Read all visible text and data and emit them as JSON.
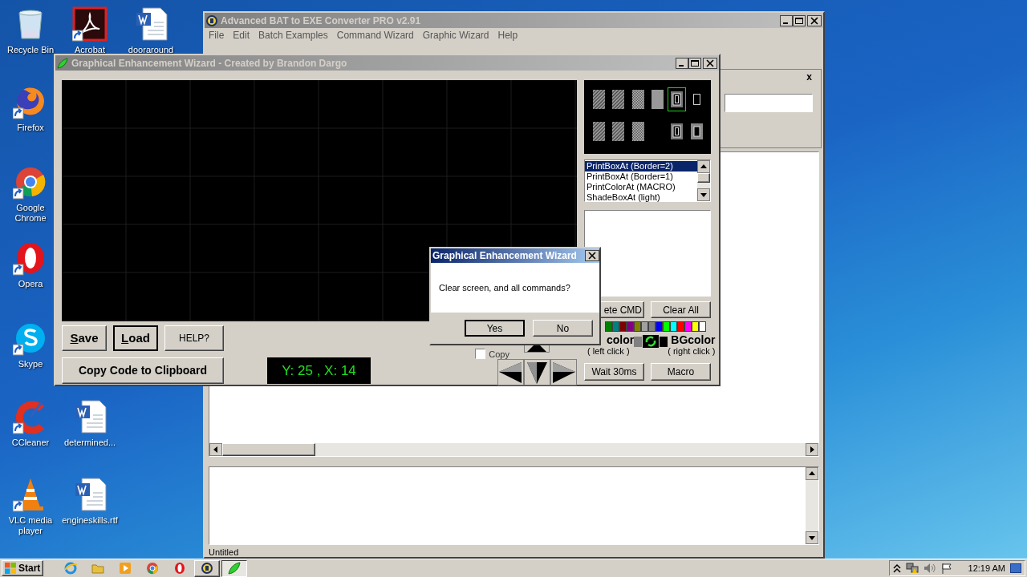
{
  "desktop_icons": [
    {
      "label": "Recycle Bin",
      "kind": "recycle",
      "shortcut": false
    },
    {
      "label": "Acrobat",
      "kind": "pdf",
      "shortcut": true
    },
    {
      "label": "dooraround",
      "kind": "word",
      "shortcut": false
    },
    {
      "label": "Firefox",
      "kind": "firefox",
      "shortcut": true
    },
    {
      "label": "Google Chrome",
      "kind": "chrome",
      "shortcut": true
    },
    {
      "label": "Opera",
      "kind": "opera",
      "shortcut": true
    },
    {
      "label": "Skype",
      "kind": "skype",
      "shortcut": true
    },
    {
      "label": "CCleaner",
      "kind": "ccleaner",
      "shortcut": true
    },
    {
      "label": "determined...",
      "kind": "word",
      "shortcut": false
    },
    {
      "label": "VLC media player",
      "kind": "vlc",
      "shortcut": true
    },
    {
      "label": "engineskills.rtf",
      "kind": "word",
      "shortcut": false
    }
  ],
  "main_window": {
    "title": "Advanced BAT to EXE Converter PRO v2.91",
    "active": false,
    "menu": [
      "File",
      "Edit",
      "Batch Examples",
      "Command Wizard",
      "Graphic Wizard",
      "Help"
    ],
    "panel_close": "x",
    "status": "Untitled"
  },
  "wizard": {
    "title": "Graphical Enhancement Wizard - Created by Brandon Dargo",
    "active": false,
    "tiles": [
      {
        "kind": "hatch",
        "selected": false
      },
      {
        "kind": "hatch",
        "selected": false
      },
      {
        "kind": "checker",
        "selected": false
      },
      {
        "kind": "solid",
        "selected": false
      },
      {
        "kind": "box2",
        "selected": true
      },
      {
        "kind": "box1",
        "selected": false
      },
      {
        "kind": "hatch",
        "selected": false
      },
      {
        "kind": "hatch",
        "selected": false
      },
      {
        "kind": "checker",
        "selected": false
      },
      {
        "kind": "empty",
        "selected": false
      },
      {
        "kind": "box2",
        "selected": false
      },
      {
        "kind": "boxfill",
        "selected": false
      }
    ],
    "commands": [
      {
        "label": "PrintBoxAt (Border=2)",
        "selected": true
      },
      {
        "label": "PrintBoxAt (Border=1)",
        "selected": false
      },
      {
        "label": "PrintColorAt (MACRO)",
        "selected": false
      },
      {
        "label": "ShadeBoxAt (light)",
        "selected": false
      }
    ],
    "buttons": {
      "save": "Save",
      "load": "Load",
      "help": "HELP?",
      "copy": "Copy Code to Clipboard",
      "delete": "ete CMD",
      "clear": "Clear All",
      "wait": "Wait 30ms",
      "macro": "Macro"
    },
    "palette": [
      {
        "color": "#008000"
      },
      {
        "color": "#008080"
      },
      {
        "color": "#800000"
      },
      {
        "color": "#800080"
      },
      {
        "color": "#808000"
      },
      {
        "color": "#a0a0a0"
      },
      {
        "color": "#808080"
      },
      {
        "color": "#0000ff"
      },
      {
        "color": "#00ff00"
      },
      {
        "color": "#00ffff"
      },
      {
        "color": "#ff0000"
      },
      {
        "color": "#ff00ff"
      },
      {
        "color": "#ffff00"
      },
      {
        "color": "#ffffff"
      }
    ],
    "fg_label": "color",
    "fg_hint": "( left click )",
    "fg_swatch": {
      "color": "#808080"
    },
    "bg_label": "BGcolor",
    "bg_hint": "( right click )",
    "bg_swatch": {
      "color": "#000000"
    },
    "coords": "Y: 25 , X: 14",
    "copy_checkbox": {
      "label": "Copy",
      "checked": false
    }
  },
  "dialog": {
    "title": "Graphical Enhancement Wizard",
    "message": "Clear screen, and all commands?",
    "buttons": [
      "Yes",
      "No"
    ]
  },
  "taskbar": {
    "start": "Start",
    "apps": [
      {
        "kind": "ie",
        "running": false,
        "active": false
      },
      {
        "kind": "folder",
        "running": false,
        "active": false
      },
      {
        "kind": "media",
        "running": false,
        "active": false
      },
      {
        "kind": "chrome",
        "running": false,
        "active": false
      },
      {
        "kind": "opera",
        "running": false,
        "active": false
      },
      {
        "kind": "gear",
        "running": true,
        "active": false
      },
      {
        "kind": "leaf",
        "running": true,
        "active": true
      }
    ],
    "time": "12:19 AM"
  }
}
